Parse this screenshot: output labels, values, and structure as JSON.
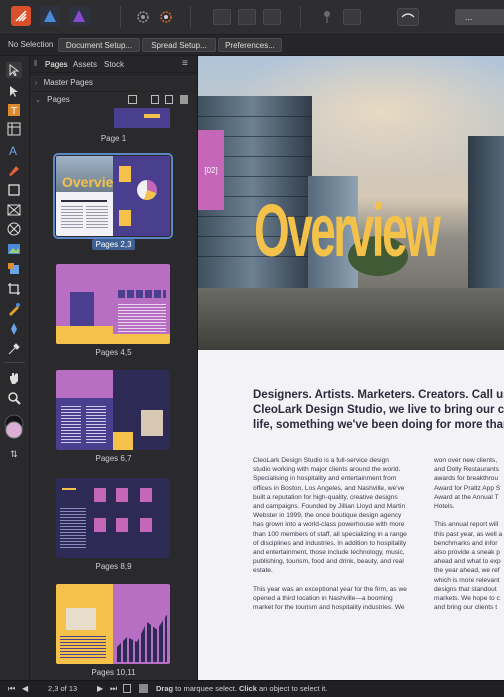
{
  "toolbar": {
    "personas": [
      {
        "name": "publisher-persona-icon",
        "color": "#d9502a"
      },
      {
        "name": "designer-persona-icon",
        "color": "#4a8ad8"
      },
      {
        "name": "photo-persona-icon",
        "color": "#8a4ad0"
      }
    ],
    "search_text": "..."
  },
  "context_bar": {
    "selection": "No Selection",
    "buttons": [
      "Document Setup...",
      "Spread Setup...",
      "Preferences..."
    ]
  },
  "panel": {
    "tabs": [
      "Pages",
      "Assets",
      "Stock"
    ],
    "master_pages_label": "Master Pages",
    "pages_label": "Pages",
    "page_labels": [
      "Page 1",
      "Pages 2,3",
      "Pages 4,5",
      "Pages 6,7",
      "Pages 8,9",
      "Pages 10,11"
    ]
  },
  "document": {
    "tab_label": "[02]",
    "title": "Overview",
    "headline": [
      "Designers. Artists. Marketers. Creators. Call us wh",
      "CleoLark Design Studio, we live to bring our client",
      "life, something we've been doing for more than tw"
    ],
    "col1": [
      "CleoLark Design Studio is a full-service design",
      "studio working with major clients around the world.",
      "Specialising in hospitality and entertainment from",
      "offices in Boston, Los Angeles, and Nashville, we've",
      "built a reputation for high-quality, creative designs",
      "and campaigns. Founded by Jillian Lloyd and Martin",
      "Webster in 1999, the once boutique design agency",
      "has grown into a world-class powerhouse with more",
      "than 100 members of staff, all specializing in a range",
      "of disciplines and industries. In addition to hospitality",
      "and entertainment, those include technology, music,",
      "publishing, tourism, food and drink, beauty, and real",
      "estate.",
      "",
      "This year was an exceptional year for the firm, as we",
      "opened a third location in Nashville—a booming",
      "market for the tourism and hospitality industries. We"
    ],
    "col2": [
      "won over new clients,",
      "and Dolly Restaurants",
      "awards for breakthrou",
      "Award for Praltz App S",
      "Award at the Annual T",
      "Hotels.",
      "",
      "This annual report will",
      "this past year, as well a",
      "benchmarks and infor",
      "also provide a sneak p",
      "ahead and what to exp",
      "the year ahead, we ref",
      "which is more relevant",
      "designs that standout",
      "markets. We hope to c",
      "and bring our clients t"
    ]
  },
  "status": {
    "page_indicator": "2,3 of 13",
    "drag_label": "Drag",
    "drag_text": " to marquee select. ",
    "click_label": "Click",
    "click_text": " an object to select it."
  },
  "colors": {
    "accent_yellow": "#f4c24a",
    "accent_purple": "#4a3f8e",
    "accent_pink": "#c566b9",
    "selection_blue": "#3d5f92"
  }
}
